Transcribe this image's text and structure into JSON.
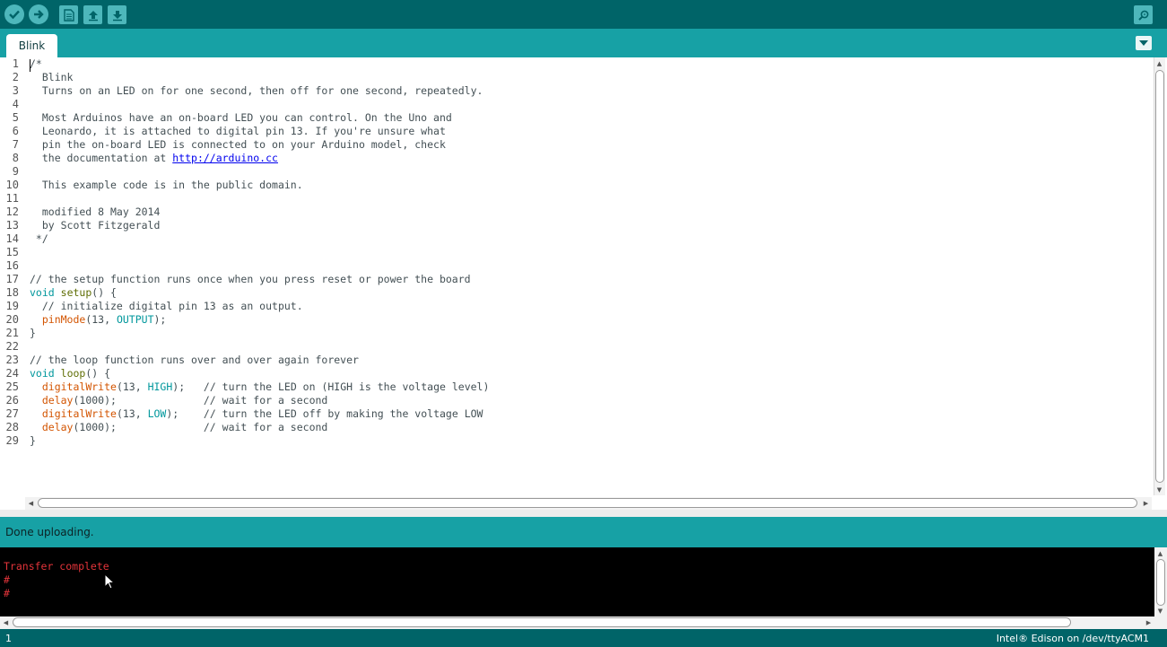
{
  "toolbar": {
    "buttons": [
      "verify-icon",
      "upload-icon",
      "new-icon",
      "open-icon",
      "save-icon",
      "serial-monitor-icon"
    ]
  },
  "tabs": [
    {
      "label": "Blink"
    }
  ],
  "editor": {
    "line_numbers": [
      "1",
      "2",
      "3",
      "4",
      "5",
      "6",
      "7",
      "8",
      "9",
      "10",
      "11",
      "12",
      "13",
      "14",
      "15",
      "16",
      "17",
      "18",
      "19",
      "20",
      "21",
      "22",
      "23",
      "24",
      "25",
      "26",
      "27",
      "28",
      "29"
    ],
    "lines": [
      "/*",
      "  Blink",
      "  Turns on an LED on for one second, then off for one second, repeatedly.",
      "",
      "  Most Arduinos have an on-board LED you can control. On the Uno and",
      "  Leonardo, it is attached to digital pin 13. If you're unsure what",
      "  pin the on-board LED is connected to on your Arduino model, check",
      "  the documentation at ",
      "",
      "  This example code is in the public domain.",
      "",
      "  modified 8 May 2014",
      "  by Scott Fitzgerald",
      " */",
      "",
      "",
      "// the setup function runs once when you press reset or power the board",
      "void setup() {",
      "  // initialize digital pin 13 as an output.",
      "  pinMode(13, OUTPUT);",
      "}",
      "",
      "// the loop function runs over and over again forever",
      "void loop() {",
      "  digitalWrite(13, HIGH);   // turn the LED on (HIGH is the voltage level)",
      "  delay(1000);              // wait for a second",
      "  digitalWrite(13, LOW);    // turn the LED off by making the voltage LOW",
      "  delay(1000);              // wait for a second",
      "}"
    ],
    "link_text": "http://arduino.cc"
  },
  "status": {
    "message": "Done uploading."
  },
  "console": {
    "lines": [
      "Transfer complete",
      "#",
      "#"
    ]
  },
  "bottombar": {
    "line": "1",
    "board": "Intel® Edison on /dev/ttyACM1"
  },
  "colors": {
    "toolbar": "#006468",
    "tabbar": "#17a1a5",
    "console_text": "#e3343a",
    "keyword": "#00979c",
    "function": "#d35400"
  }
}
